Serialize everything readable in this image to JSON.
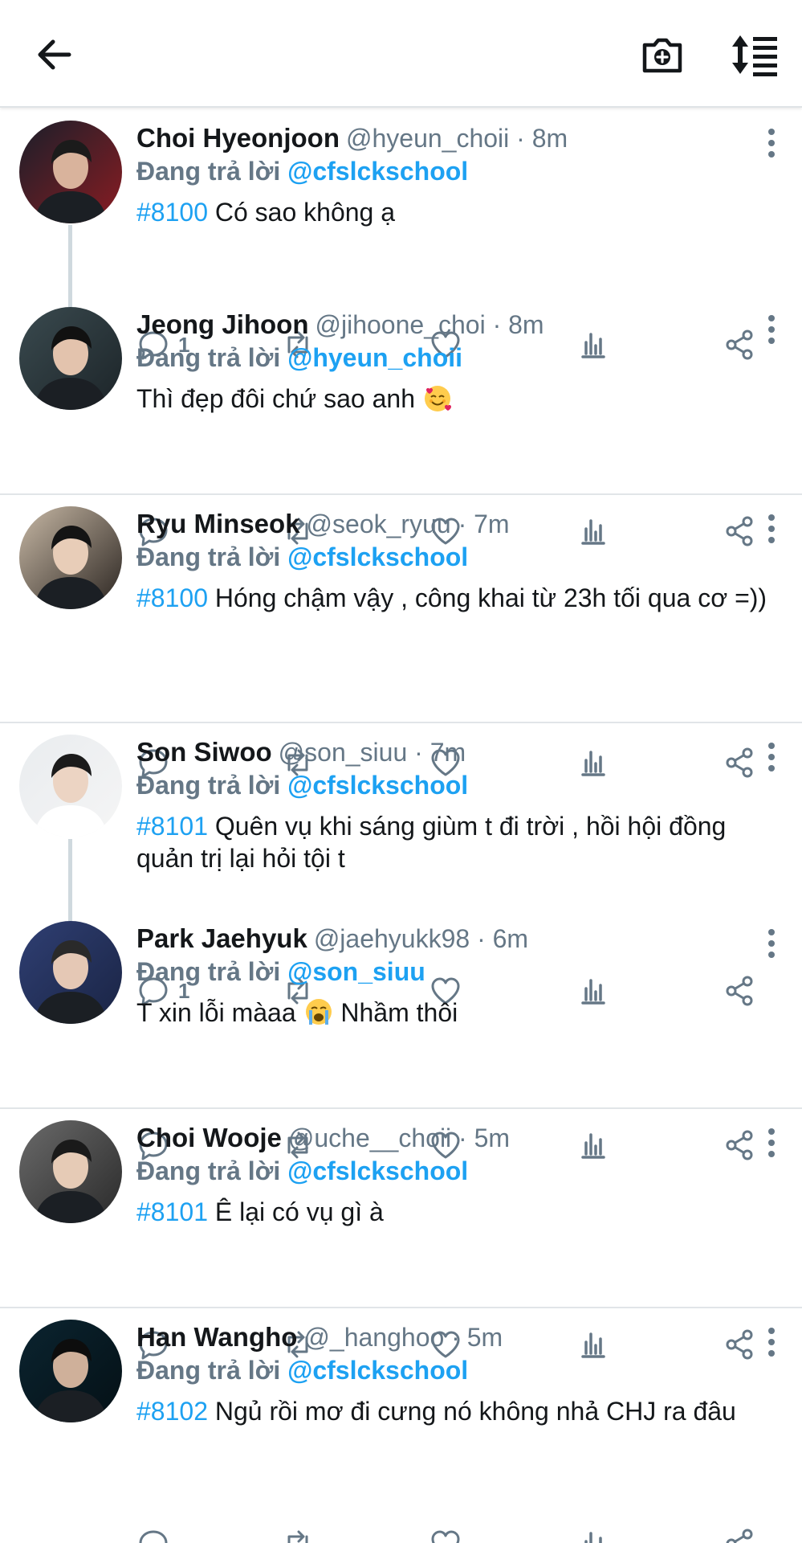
{
  "header": {
    "back_icon": "arrow-left-icon",
    "camera_icon": "camera-plus-icon",
    "sort_icon": "sort-list-icon"
  },
  "colors": {
    "accent": "#1da1f2",
    "muted": "#657786",
    "text": "#14171a",
    "divider": "#e1e5e8"
  },
  "tweets": [
    {
      "name": "Choi Hyeonjoon",
      "meta": "@hyeun_choii · 8m",
      "reply_prefix": "Đang trả lời ",
      "reply_to": "@cfslckschool",
      "tag": "#8100",
      "text": " Có sao không ạ",
      "reply_count": "1"
    },
    {
      "name": "Jeong Jihoon",
      "meta": "@jihoone_choi · 8m",
      "reply_prefix": "Đang trả lời ",
      "reply_to": "@hyeun_choii",
      "tag": "",
      "text": "Thì đẹp đôi chứ sao anh ",
      "emoji": "smiling-face-with-hearts",
      "reply_count": ""
    },
    {
      "name": "Ryu Minseok",
      "meta": "@seok_ryuu · 7m",
      "reply_prefix": "Đang trả lời ",
      "reply_to": "@cfslckschool",
      "tag": "#8100",
      "text": " Hóng chậm vậy , công khai từ 23h tối qua cơ =))",
      "reply_count": ""
    },
    {
      "name": "Son Siwoo",
      "meta": "@son_siuu · 7m",
      "reply_prefix": "Đang trả lời ",
      "reply_to": "@cfslckschool",
      "tag": "#8101",
      "text": " Quên vụ khi sáng giùm t đi trời , hồi hội đồng quản trị lại hỏi tội t",
      "reply_count": "1"
    },
    {
      "name": "Park Jaehyuk",
      "meta": "@jaehyukk98 · 6m",
      "reply_prefix": "Đang trả lời ",
      "reply_to": "@son_siuu",
      "tag": "",
      "text": "T xin lỗi màaa ",
      "emoji": "loudly-crying-face",
      "text_after": " Nhầm thôi",
      "reply_count": ""
    },
    {
      "name": "Choi Wooje",
      "meta": "@uche__choii · 5m",
      "reply_prefix": "Đang trả lời ",
      "reply_to": "@cfslckschool",
      "tag": "#8101",
      "text": " Ê lại có vụ gì à",
      "reply_count": ""
    },
    {
      "name": "Han Wangho",
      "meta": "@_hanghoo · 5m",
      "reply_prefix": "Đang trả lời ",
      "reply_to": "@cfslckschool",
      "tag": "#8102",
      "text": " Ngủ rồi mơ đi cưng nó không nhả CHJ ra đâu",
      "reply_count": ""
    }
  ]
}
